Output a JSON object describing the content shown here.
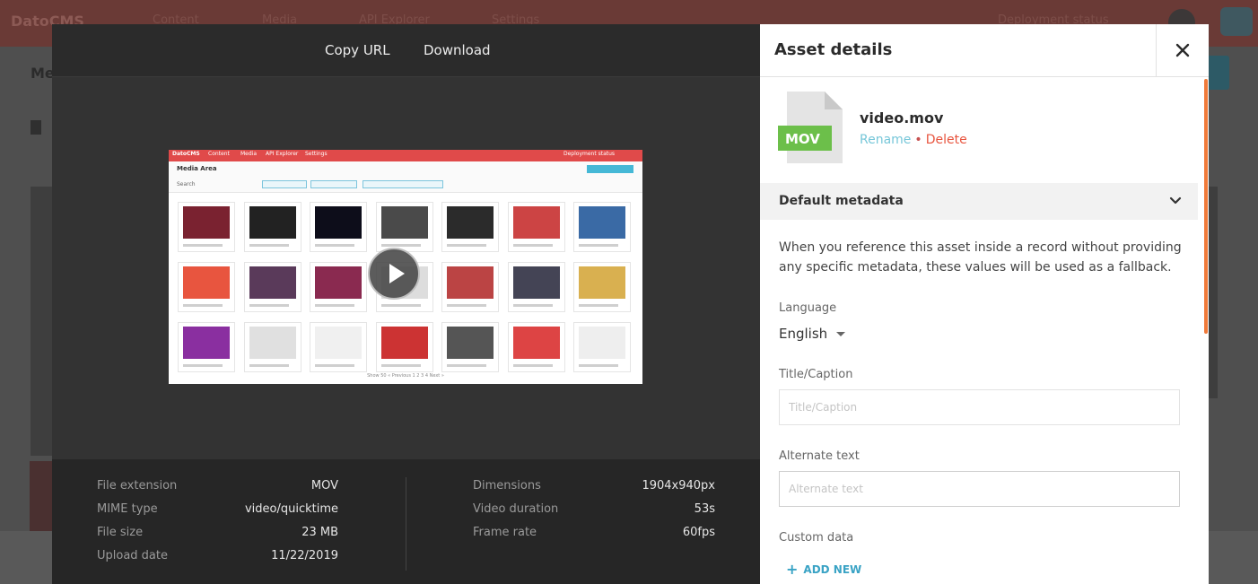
{
  "background_app": {
    "logo": "DatoCMS",
    "nav": [
      "Content",
      "Media",
      "API Explorer",
      "Settings"
    ],
    "deployment_status": "Deployment status",
    "page_heading": "Me"
  },
  "toolbar": {
    "copy_url_label": "Copy URL",
    "download_label": "Download"
  },
  "preview": {
    "app_title": "Media Area",
    "search_label": "Search",
    "pager": "Show 50  « Previous  1  2  3  4  Next »"
  },
  "file_info": {
    "left": [
      {
        "label": "File extension",
        "value": "MOV"
      },
      {
        "label": "MIME type",
        "value": "video/quicktime"
      },
      {
        "label": "File size",
        "value": "23 MB"
      },
      {
        "label": "Upload date",
        "value": "11/22/2019"
      }
    ],
    "right": [
      {
        "label": "Dimensions",
        "value": "1904x940px"
      },
      {
        "label": "Video duration",
        "value": "53s"
      },
      {
        "label": "Frame rate",
        "value": "60fps"
      }
    ]
  },
  "sidebar": {
    "title": "Asset details",
    "file_badge": "MOV",
    "file_name": "video.mov",
    "rename_label": "Rename",
    "separator": "•",
    "delete_label": "Delete",
    "metadata_section_label": "Default metadata",
    "metadata_description": "When you reference this asset inside a record without providing any specific metadata, these values will be used as a fallback.",
    "language_label": "Language",
    "language_value": "English",
    "title_label": "Title/Caption",
    "title_placeholder": "Title/Caption",
    "title_value": "",
    "alt_label": "Alternate text",
    "alt_placeholder": "Alternate text",
    "alt_value": "",
    "custom_data_label": "Custom data",
    "add_new_label": "ADD NEW"
  },
  "colors": {
    "accent_orange": "#f07a3a",
    "link_teal": "#77c7d9",
    "delete_red": "#e8553f",
    "badge_green": "#6cbf4a",
    "add_new_blue": "#3aa3c5"
  }
}
